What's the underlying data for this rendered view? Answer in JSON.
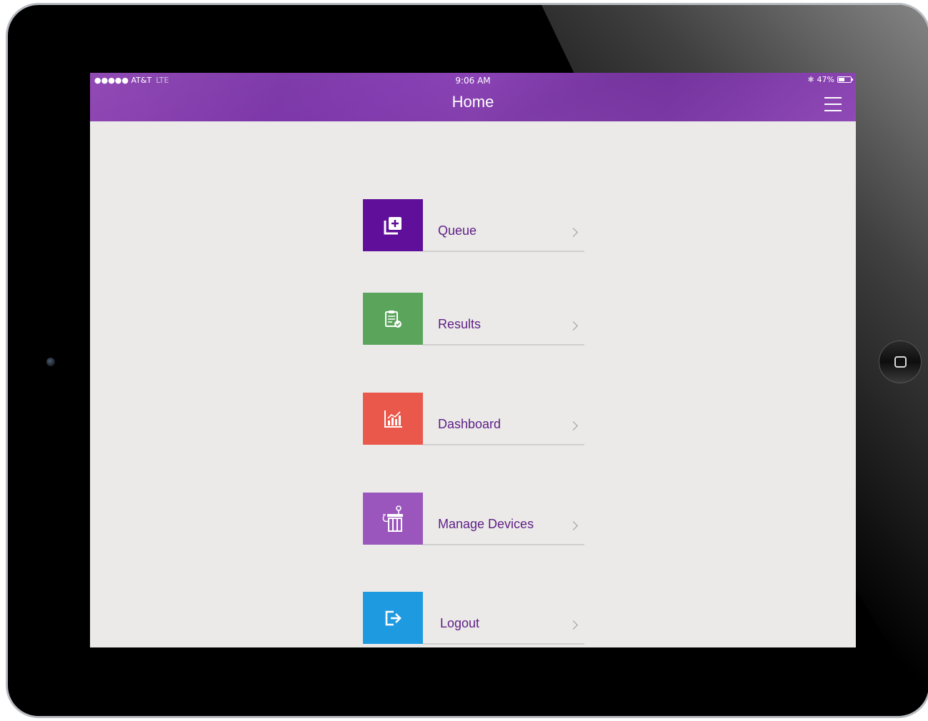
{
  "status_bar": {
    "signal": "●●●●● AT&T",
    "network": "LTE",
    "time": "9:06 AM",
    "bluetooth": "✱",
    "battery_text": "47%",
    "battery_level": 0.47
  },
  "header": {
    "title": "Home",
    "menu_icon": "hamburger-icon"
  },
  "menu": {
    "items": [
      {
        "label": "Queue",
        "icon": "add-to-queue-icon",
        "color": "#5f0f99"
      },
      {
        "label": "Results",
        "icon": "clipboard-check-icon",
        "color": "#5aa55b"
      },
      {
        "label": "Dashboard",
        "icon": "bar-chart-icon",
        "color": "#e9584b"
      },
      {
        "label": "Manage Devices",
        "icon": "device-icon",
        "color": "#9a56bd"
      },
      {
        "label": "Logout",
        "icon": "logout-icon",
        "color": "#1e9be0"
      }
    ]
  },
  "colors": {
    "header_purple": "#8a3fb0",
    "label_purple": "#5e1e86",
    "background": "#ebeae8"
  }
}
